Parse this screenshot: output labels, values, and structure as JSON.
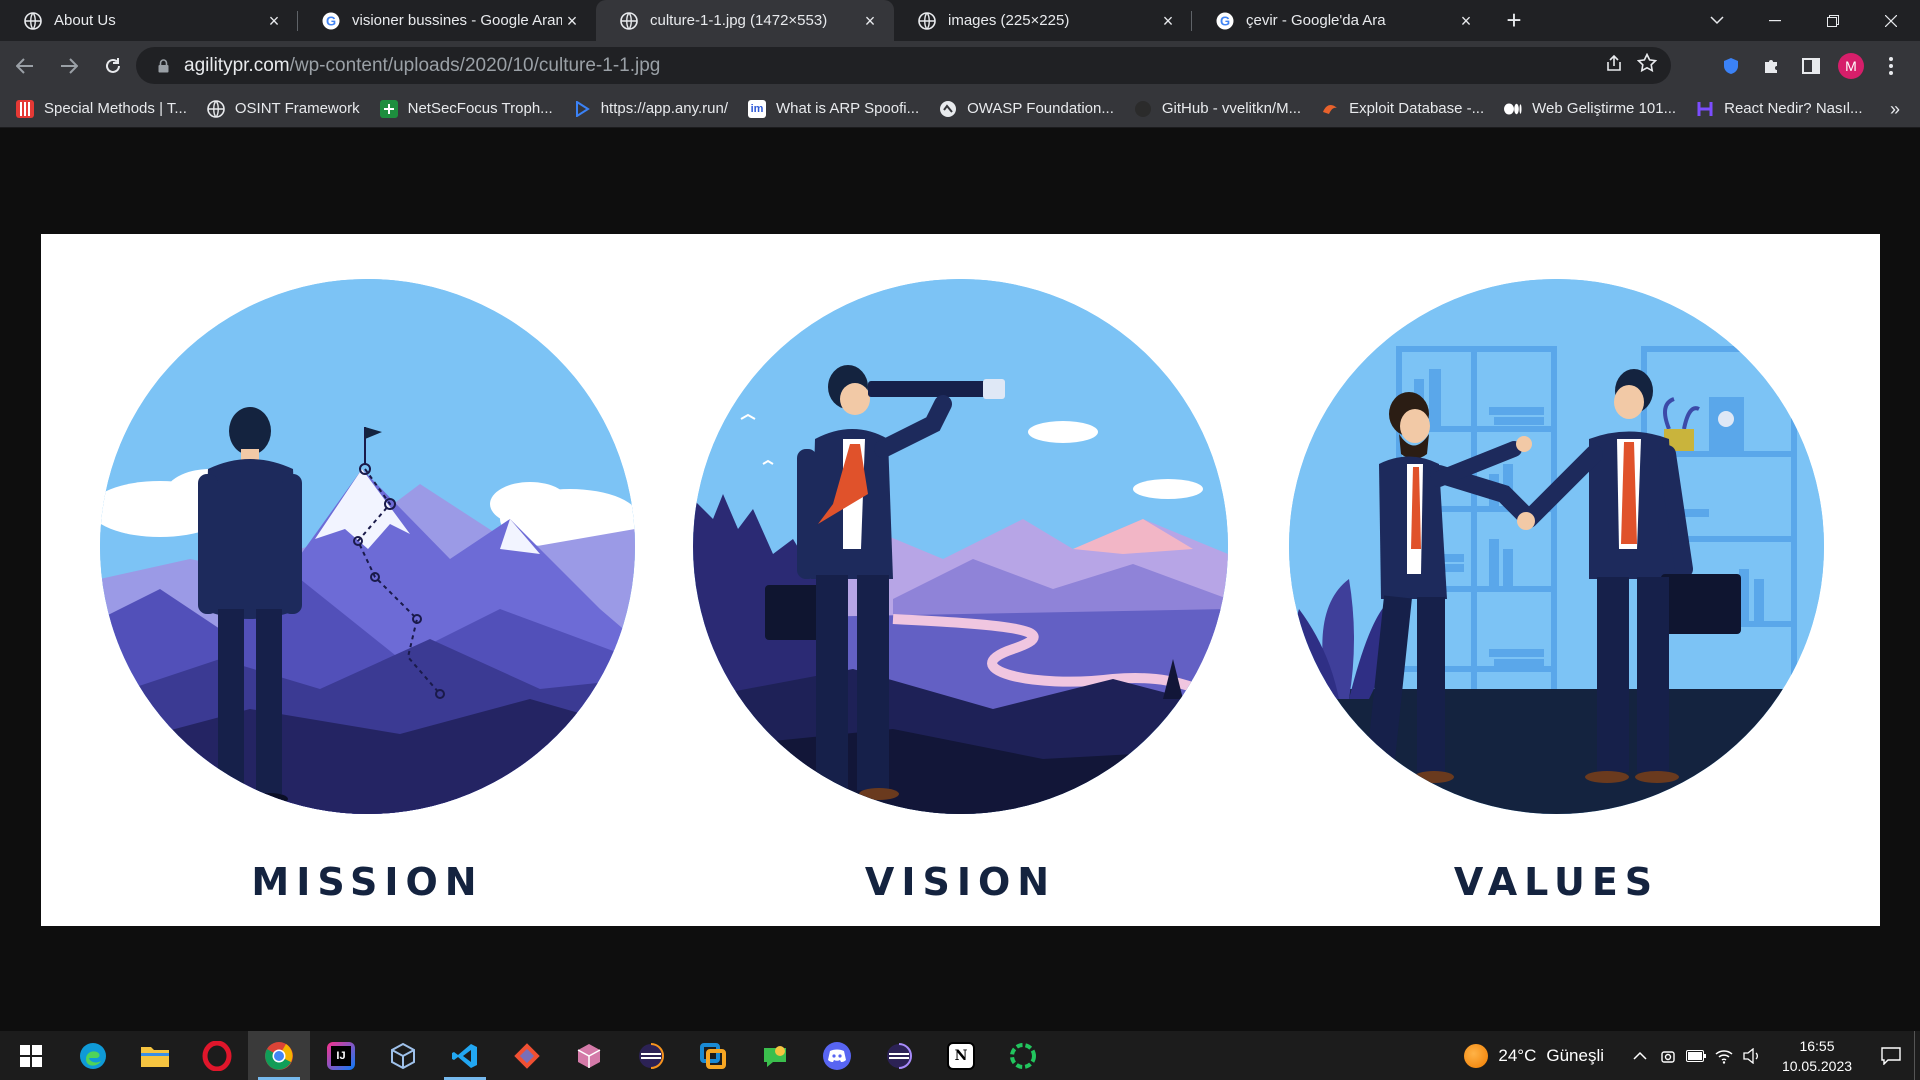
{
  "tabs": [
    {
      "title": "About Us",
      "icon": "globe-icon",
      "active": false
    },
    {
      "title": "visioner bussines - Google Arama",
      "icon": "google-icon",
      "active": false
    },
    {
      "title": "culture-1-1.jpg (1472×553)",
      "icon": "globe-icon",
      "active": true
    },
    {
      "title": "images (225×225)",
      "icon": "globe-icon",
      "active": false
    },
    {
      "title": "çevir - Google'da Ara",
      "icon": "google-icon",
      "active": false
    }
  ],
  "address": {
    "host": "agilitypr.com",
    "path": "/wp-content/uploads/2020/10/culture-1-1.jpg"
  },
  "profile": {
    "initial": "M",
    "color": "#d61e6a"
  },
  "bookmarks": [
    {
      "label": "Special Methods | T...",
      "icon": "red-bookmark-icon",
      "color": "#e53935"
    },
    {
      "label": "OSINT Framework",
      "icon": "globe-icon",
      "color": "#e8eaed"
    },
    {
      "label": "NetSecFocus Troph...",
      "icon": "sheets-icon",
      "color": "#1e8e3e"
    },
    {
      "label": "https://app.any.run/",
      "icon": "anyrun-icon",
      "color": "#3b82f6"
    },
    {
      "label": "What is ARP Spoofi...",
      "icon": "imperva-icon",
      "color": "#2c58d6"
    },
    {
      "label": "OWASP Foundation...",
      "icon": "owasp-icon",
      "color": "#e8eaed"
    },
    {
      "label": "GitHub - vvelitkn/M...",
      "icon": "github-icon",
      "color": "#2b2b2b"
    },
    {
      "label": "Exploit Database -...",
      "icon": "exploitdb-icon",
      "color": "#e8622c"
    },
    {
      "label": "Web Geliştirme 101...",
      "icon": "medium-icon",
      "color": "#ffffff"
    },
    {
      "label": "React Nedir? Nasıl...",
      "icon": "hashnode-icon",
      "color": "#7c4dff"
    }
  ],
  "bookmarks_more": "»",
  "image": {
    "captions": [
      "MISSION",
      "VISION",
      "VALUES"
    ],
    "colors": {
      "sky": "#7cc3f5",
      "navy": "#14233f",
      "mountain": "#6d6bd6"
    }
  },
  "taskbar": {
    "apps": [
      {
        "name": "edge",
        "icon": "edge-icon",
        "color": "#0f9ad7"
      },
      {
        "name": "file-explorer",
        "icon": "folder-icon",
        "color": "#f6c440"
      },
      {
        "name": "opera",
        "icon": "opera-icon",
        "color": "#e0162b"
      },
      {
        "name": "chrome",
        "icon": "chrome-icon",
        "color": "#4285f4",
        "active": true
      },
      {
        "name": "intellij",
        "icon": "intellij-icon",
        "color": "#1a1a8c"
      },
      {
        "name": "virtualbox",
        "icon": "virtualbox-icon",
        "color": "#1b4f9c"
      },
      {
        "name": "vscode",
        "icon": "vscode-icon",
        "color": "#22a7f2"
      },
      {
        "name": "git",
        "icon": "git-icon",
        "color": "#7a6fb8"
      },
      {
        "name": "app-cube",
        "icon": "cube-icon",
        "color": "#d47aa8"
      },
      {
        "name": "eclipse",
        "icon": "eclipse-icon",
        "color": "#2c2255"
      },
      {
        "name": "app-square",
        "icon": "square-app-icon",
        "color": "#1a8ad4"
      },
      {
        "name": "app-chat",
        "icon": "chat-icon",
        "color": "#3bbf4d"
      },
      {
        "name": "discord",
        "icon": "discord-icon",
        "color": "#5865f2"
      },
      {
        "name": "eclipse-2",
        "icon": "eclipse-icon",
        "color": "#2c2255"
      },
      {
        "name": "notion",
        "icon": "notion-icon",
        "color": "#ffffff"
      },
      {
        "name": "app-ring",
        "icon": "ring-icon",
        "color": "#22c55e"
      }
    ],
    "weather": {
      "temp": "24°C",
      "condition": "Güneşli"
    },
    "time": "16:55",
    "date": "10.05.2023"
  }
}
